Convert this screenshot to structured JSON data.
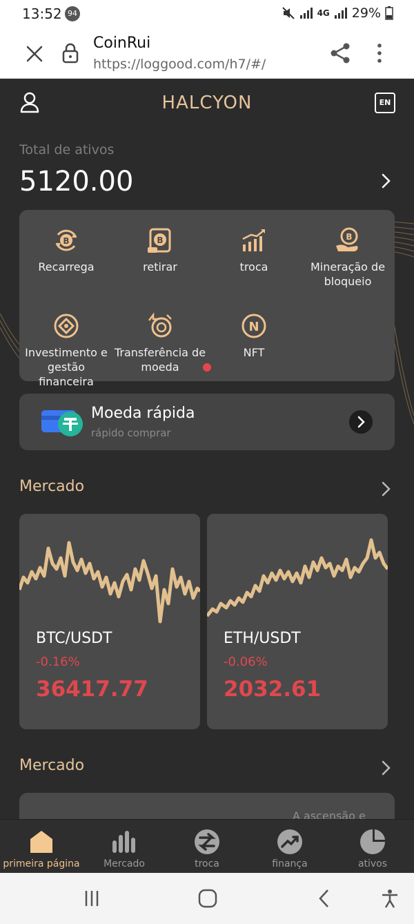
{
  "status_bar": {
    "time": "13:52",
    "notification_count": "94",
    "battery": "29%",
    "network": "4G"
  },
  "browser": {
    "site_name": "CoinRui",
    "url": "https://loggood.com/h7/#/"
  },
  "header": {
    "title": "HALCYON",
    "language_button": "EN"
  },
  "assets": {
    "label": "Total de ativos",
    "value": "5120.00"
  },
  "actions": [
    {
      "label": "Recarrega",
      "icon": "bitcoin-refresh-icon"
    },
    {
      "label": "retirar",
      "icon": "bitcoin-withdraw-icon"
    },
    {
      "label": "troca",
      "icon": "trend-bars-icon"
    },
    {
      "label": "Mineração de bloqueio",
      "icon": "bitcoin-hand-icon"
    },
    {
      "label": "Investimento e gestão financeira",
      "icon": "diamond-icon"
    },
    {
      "label": "Transferência de moeda",
      "icon": "coin-transfer-icon"
    },
    {
      "label": "NFT",
      "icon": "nft-icon"
    }
  ],
  "quick_buy": {
    "title": "Moeda rápida",
    "subtitle": "rápido comprar"
  },
  "market": {
    "title": "Mercado",
    "cards": [
      {
        "pair": "BTC/USDT",
        "change": "-0.16%",
        "price": "36417.77"
      },
      {
        "pair": "ETH/USDT",
        "change": "-0.06%",
        "price": "2032.61"
      }
    ]
  },
  "market2": {
    "title": "Mercado",
    "card_text": "A ascensão e"
  },
  "tabs": [
    {
      "label": "primeira página",
      "icon": "home-icon",
      "active": true
    },
    {
      "label": "Mercado",
      "icon": "bar-chart-icon",
      "active": false
    },
    {
      "label": "troca",
      "icon": "exchange-icon",
      "active": false
    },
    {
      "label": "finança",
      "icon": "finance-icon",
      "active": false
    },
    {
      "label": "ativos",
      "icon": "pie-chart-icon",
      "active": false
    }
  ],
  "colors": {
    "accent": "#e6c49a",
    "negative": "#e0484e",
    "panel": "#4a4a4a",
    "background": "#2b2b2b"
  }
}
